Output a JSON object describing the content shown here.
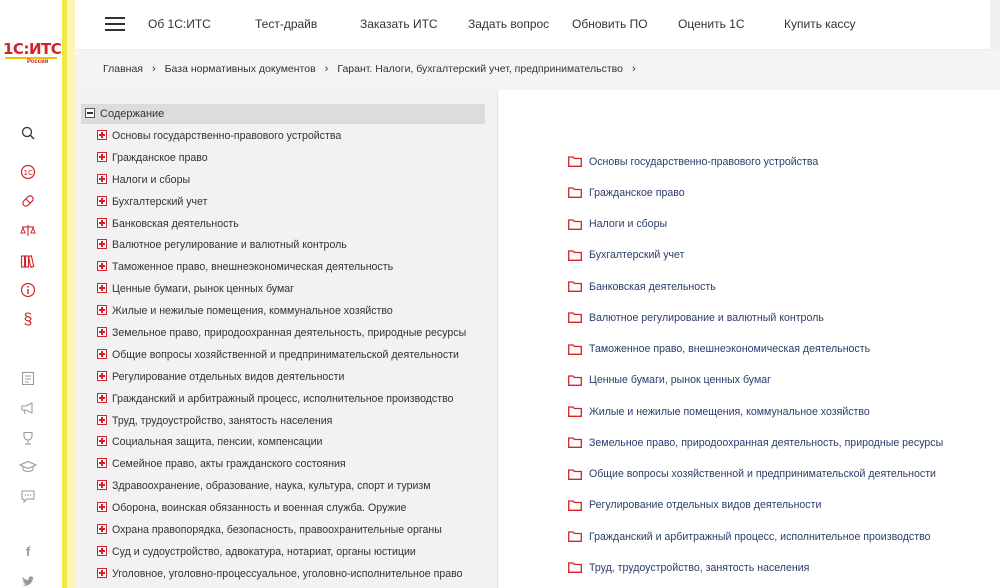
{
  "logo": {
    "brand": "1С:ИТС",
    "region": "Россия"
  },
  "rail": {
    "icons": [
      "search-icon",
      "1c-icon",
      "pills-icon",
      "scales-icon",
      "books-icon",
      "info-icon",
      "paragraph-icon",
      "document-icon",
      "megaphone-icon",
      "trophy-icon",
      "graduation-cap-icon",
      "chat-icon",
      "facebook-icon",
      "twitter-icon"
    ]
  },
  "nav": {
    "items": [
      "Об 1С:ИТС",
      "Тест-драйв",
      "Заказать ИТС",
      "Задать вопрос",
      "Обновить ПО",
      "Оценить 1С",
      "Купить кассу"
    ]
  },
  "breadcrumb": {
    "items": [
      "Главная",
      "База нормативных документов",
      "Гарант. Налоги, бухгалтерский учет, предпринимательство"
    ],
    "separator": "›"
  },
  "tree": {
    "root": "Содержание",
    "items": [
      "Основы государственно-правового устройства",
      "Гражданское право",
      "Налоги и сборы",
      "Бухгалтерский учет",
      "Банковская деятельность",
      "Валютное регулирование и валютный контроль",
      "Таможенное право, внешнеэкономическая деятельность",
      "Ценные бумаги, рынок ценных бумаг",
      "Жилые и нежилые помещения, коммунальное хозяйство",
      "Земельное право, природоохранная деятельность, природные ресурсы",
      "Общие вопросы хозяйственной и предпринимательской деятельности",
      "Регулирование отдельных видов деятельности",
      "Гражданский и арбитражный процесс, исполнительное производство",
      "Труд, трудоустройство, занятость населения",
      "Социальная защита, пенсии, компенсации",
      "Семейное право, акты гражданского состояния",
      "Здравоохранение, образование, наука, культура, спорт и туризм",
      "Оборона, воинская обязанность и военная служба. Оружие",
      "Охрана правопорядка, безопасность, правоохранительные органы",
      "Суд и судоустройство, адвокатура, нотариат, органы юстиции",
      "Уголовное, уголовно-процессуальное, уголовно-исполнительное право"
    ]
  },
  "content": {
    "items": [
      "Основы государственно-правового устройства",
      "Гражданское право",
      "Налоги и сборы",
      "Бухгалтерский учет",
      "Банковская деятельность",
      "Валютное регулирование и валютный контроль",
      "Таможенное право, внешнеэкономическая деятельность",
      "Ценные бумаги, рынок ценных бумаг",
      "Жилые и нежилые помещения, коммунальное хозяйство",
      "Земельное право, природоохранная деятельность, природные ресурсы",
      "Общие вопросы хозяйственной и предпринимательской деятельности",
      "Регулирование отдельных видов деятельности",
      "Гражданский и арбитражный процесс, исполнительное производство",
      "Труд, трудоустройство, занятость населения"
    ]
  },
  "colors": {
    "accent": "#d2232a",
    "stripe": "#f5e74a",
    "link": "#2b3d6b"
  }
}
